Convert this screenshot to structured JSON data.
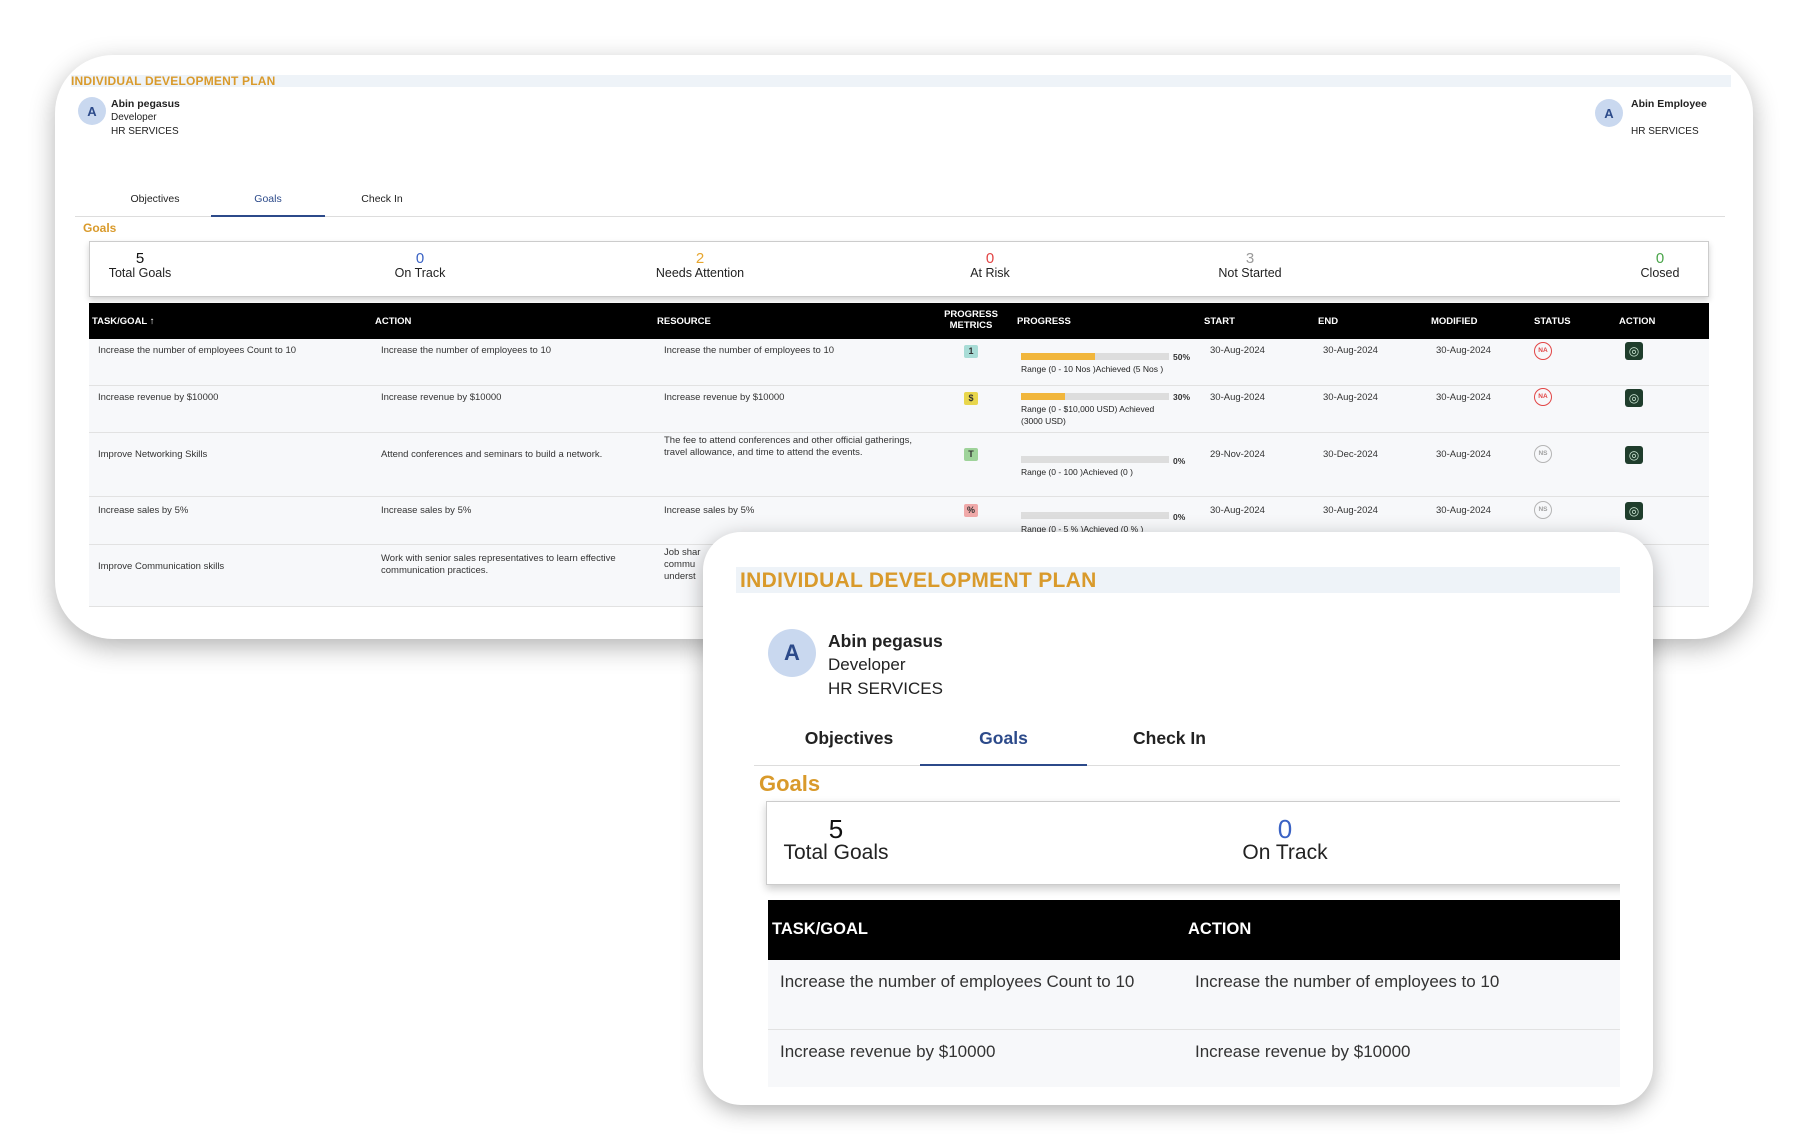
{
  "header": {
    "title": "INDIVIDUAL DEVELOPMENT PLAN"
  },
  "employee": {
    "avatar": "A",
    "name": "Abin pegasus",
    "role": "Developer",
    "department": "HR SERVICES"
  },
  "manager": {
    "avatar": "A",
    "name": "Abin Employee",
    "department": "HR SERVICES"
  },
  "tabs": [
    {
      "label": "Objectives",
      "active": false
    },
    {
      "label": "Goals",
      "active": true
    },
    {
      "label": "Check In",
      "active": false
    }
  ],
  "section_title": "Goals",
  "summary": [
    {
      "value": "5",
      "label": "Total Goals",
      "color": "#111111"
    },
    {
      "value": "0",
      "label": "On Track",
      "color": "#3a62c4"
    },
    {
      "value": "2",
      "label": "Needs Attention",
      "color": "#e6a52e"
    },
    {
      "value": "0",
      "label": "At Risk",
      "color": "#e24545"
    },
    {
      "value": "3",
      "label": "Not Started",
      "color": "#9a9a9a"
    },
    {
      "value": "0",
      "label": "Closed",
      "color": "#4aa54a"
    }
  ],
  "columns": {
    "task": "TASK/GOAL",
    "sort_icon": "↑",
    "action": "ACTION",
    "resource": "RESOURCE",
    "metrics_1": "PROGRESS",
    "metrics_2": "METRICS",
    "progress": "PROGRESS",
    "start": "START",
    "end": "END",
    "modified": "MODIFIED",
    "status": "STATUS",
    "row_action": "ACTION"
  },
  "rows": [
    {
      "task": "Increase the number of employees Count to 10",
      "action": "Increase the number of employees to 10",
      "resource": "Increase the number of employees to 10",
      "metric": "1",
      "metric_color": "#a8dcd6",
      "progress": 0.5,
      "pct": "50%",
      "range": "Range (0 - 10 Nos )Achieved (5 Nos )",
      "start": "30-Aug-2024",
      "end": "30-Aug-2024",
      "modified": "30-Aug-2024",
      "status": "NA"
    },
    {
      "task": "Increase revenue by $10000",
      "action": "Increase revenue by $10000",
      "resource": "Increase revenue by $10000",
      "metric": "$",
      "metric_color": "#e8d64c",
      "progress": 0.3,
      "pct": "30%",
      "range": "Range (0 - $10,000 USD) Achieved (3000 USD)",
      "start": "30-Aug-2024",
      "end": "30-Aug-2024",
      "modified": "30-Aug-2024",
      "status": "NA"
    },
    {
      "task": "Improve Networking Skills",
      "action": "Attend conferences and seminars to build a network.",
      "resource": "The fee to attend conferences and other official gatherings, travel allowance, and time to attend the events.",
      "metric": "T",
      "metric_color": "#9fd39a",
      "progress": 0,
      "pct": "0%",
      "range": "Range (0 - 100 )Achieved (0 )",
      "start": "29-Nov-2024",
      "end": "30-Dec-2024",
      "modified": "30-Aug-2024",
      "status": "NS"
    },
    {
      "task": "Increase sales by 5%",
      "action": "Increase sales by 5%",
      "resource": "Increase sales by 5%",
      "metric": "%",
      "metric_color": "#f0a9a9",
      "progress": 0,
      "pct": "0%",
      "range": "Range (0 - 5 % )Achieved (0 % )",
      "start": "30-Aug-2024",
      "end": "30-Aug-2024",
      "modified": "30-Aug-2024",
      "status": "NS"
    },
    {
      "task": "Improve Communication skills",
      "action": "Work with senior sales representatives to learn effective communication practices.",
      "resource_partial": "Job shar\ncommu\nunderst"
    }
  ],
  "icons": {
    "row_action": "target-icon",
    "sort": "sort-arrow-icon"
  }
}
